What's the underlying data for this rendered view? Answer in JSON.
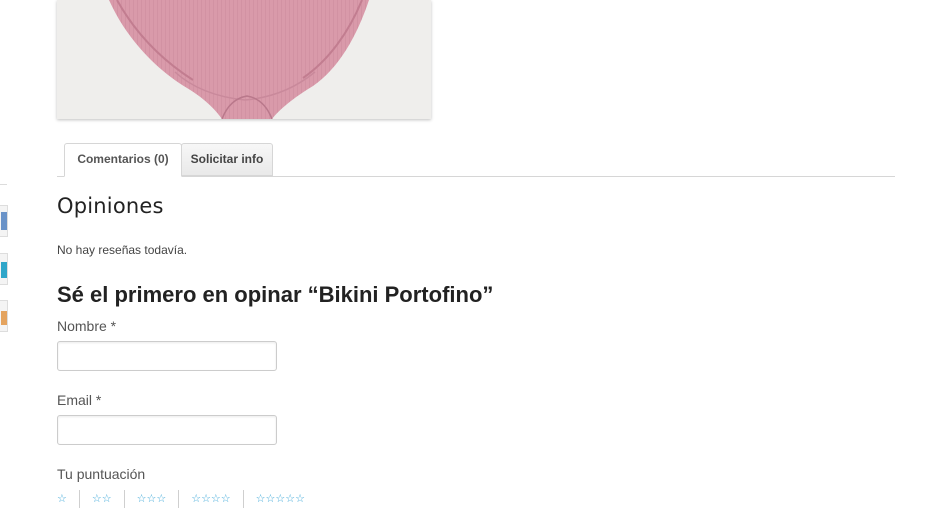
{
  "tabs": [
    {
      "label": "Comentarios (0)",
      "active": true
    },
    {
      "label": "Solicitar info",
      "active": false
    }
  ],
  "reviews": {
    "heading": "Opiniones",
    "empty_text": "No hay reseñas todavía.",
    "form_title": "Sé el primero en opinar “Bikini Portofino”",
    "name_label": "Nombre *",
    "email_label": "Email *",
    "rating_label": "Tu puntuación",
    "rating_options": [
      "☆",
      "☆☆",
      "☆☆☆",
      "☆☆☆☆",
      "☆☆☆☆☆"
    ]
  },
  "colors": {
    "accent_star": "#3fa9d9",
    "product_pink": "#d99aaa"
  },
  "icons": {
    "product_image": "pink-bikini-bottom-image"
  }
}
